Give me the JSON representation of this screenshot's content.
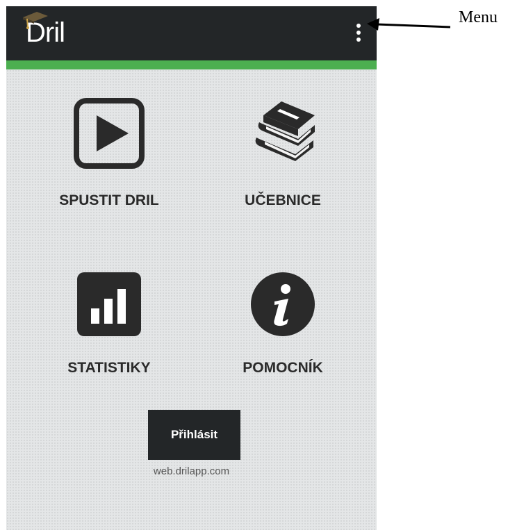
{
  "app": {
    "logo_text": "Dril",
    "menu_icon": "more-vert-icon"
  },
  "colors": {
    "appbar": "#232628",
    "accent": "#4caf50",
    "background": "#e4e6e7",
    "icon": "#2a2a2a"
  },
  "tiles": [
    {
      "label": "SPUSTIT DRIL",
      "icon": "play-icon"
    },
    {
      "label": "UČEBNICE",
      "icon": "books-icon"
    },
    {
      "label": "STATISTIKY",
      "icon": "bar-chart-icon"
    },
    {
      "label": "POMOCNÍK",
      "icon": "info-icon"
    }
  ],
  "login": {
    "button_label": "Přihlásit",
    "link_text": "web.drilapp.com"
  },
  "annotation": {
    "label": "Menu"
  }
}
